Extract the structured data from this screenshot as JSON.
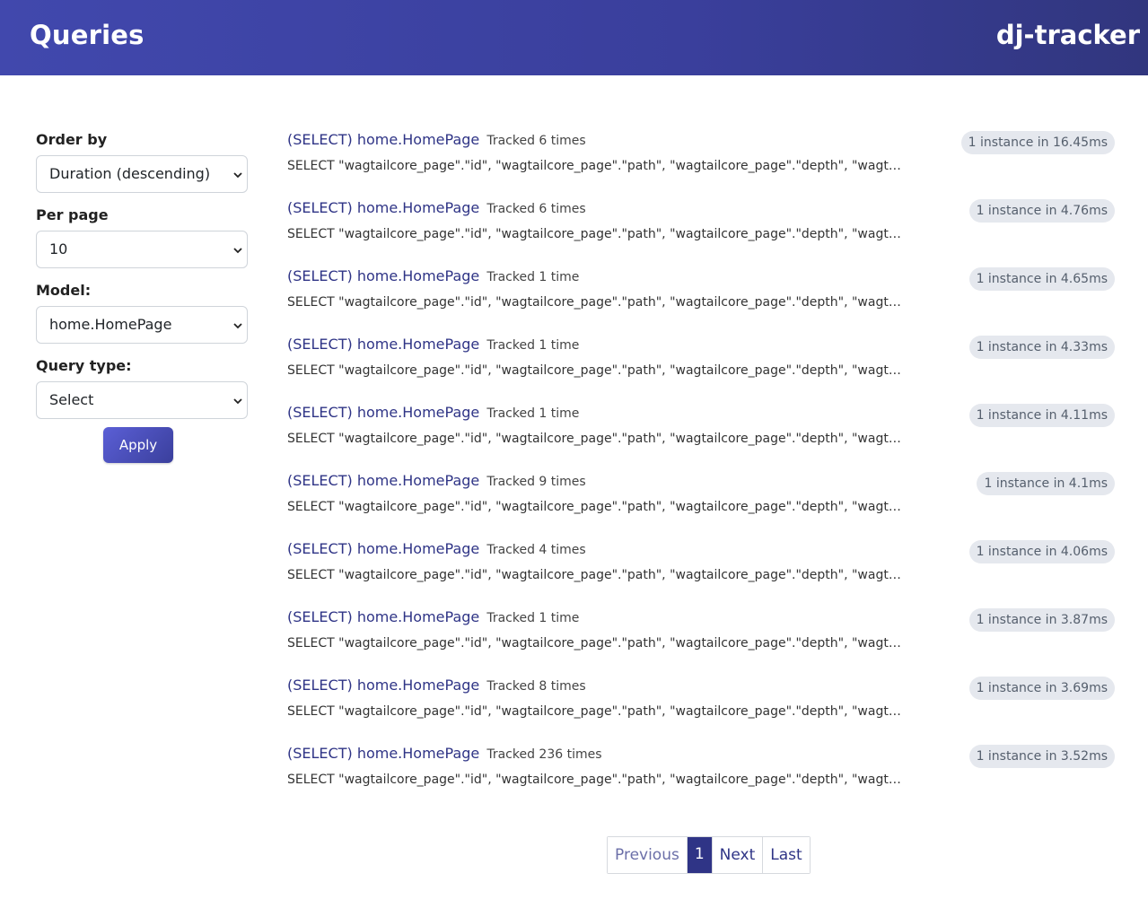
{
  "header": {
    "title": "Queries",
    "brand": "dj-tracker"
  },
  "filters": {
    "order_by": {
      "label": "Order by",
      "value": "Duration (descending)"
    },
    "per_page": {
      "label": "Per page",
      "value": "10"
    },
    "model": {
      "label": "Model:",
      "value": "home.HomePage"
    },
    "query_type": {
      "label": "Query type:",
      "value": "Select"
    },
    "apply_label": "Apply"
  },
  "queries": [
    {
      "type": "(SELECT)",
      "model": "home.HomePage",
      "tracked": "Tracked 6 times",
      "sql": "SELECT \"wagtailcore_page\".\"id\", \"wagtailcore_page\".\"path\", \"wagtailcore_page\".\"depth\", \"wagtailcore...",
      "badge": "1 instance in 16.45ms"
    },
    {
      "type": "(SELECT)",
      "model": "home.HomePage",
      "tracked": "Tracked 6 times",
      "sql": "SELECT \"wagtailcore_page\".\"id\", \"wagtailcore_page\".\"path\", \"wagtailcore_page\".\"depth\", \"wagtailcore...",
      "badge": "1 instance in 4.76ms"
    },
    {
      "type": "(SELECT)",
      "model": "home.HomePage",
      "tracked": "Tracked 1 time",
      "sql": "SELECT \"wagtailcore_page\".\"id\", \"wagtailcore_page\".\"path\", \"wagtailcore_page\".\"depth\", \"wagtailcore...",
      "badge": "1 instance in 4.65ms"
    },
    {
      "type": "(SELECT)",
      "model": "home.HomePage",
      "tracked": "Tracked 1 time",
      "sql": "SELECT \"wagtailcore_page\".\"id\", \"wagtailcore_page\".\"path\", \"wagtailcore_page\".\"depth\", \"wagtailcore...",
      "badge": "1 instance in 4.33ms"
    },
    {
      "type": "(SELECT)",
      "model": "home.HomePage",
      "tracked": "Tracked 1 time",
      "sql": "SELECT \"wagtailcore_page\".\"id\", \"wagtailcore_page\".\"path\", \"wagtailcore_page\".\"depth\", \"wagtailcore...",
      "badge": "1 instance in 4.11ms"
    },
    {
      "type": "(SELECT)",
      "model": "home.HomePage",
      "tracked": "Tracked 9 times",
      "sql": "SELECT \"wagtailcore_page\".\"id\", \"wagtailcore_page\".\"path\", \"wagtailcore_page\".\"depth\", \"wagtailcore...",
      "badge": "1 instance in 4.1ms"
    },
    {
      "type": "(SELECT)",
      "model": "home.HomePage",
      "tracked": "Tracked 4 times",
      "sql": "SELECT \"wagtailcore_page\".\"id\", \"wagtailcore_page\".\"path\", \"wagtailcore_page\".\"depth\", \"wagtailcore...",
      "badge": "1 instance in 4.06ms"
    },
    {
      "type": "(SELECT)",
      "model": "home.HomePage",
      "tracked": "Tracked 1 time",
      "sql": "SELECT \"wagtailcore_page\".\"id\", \"wagtailcore_page\".\"path\", \"wagtailcore_page\".\"depth\", \"wagtailcore...",
      "badge": "1 instance in 3.87ms"
    },
    {
      "type": "(SELECT)",
      "model": "home.HomePage",
      "tracked": "Tracked 8 times",
      "sql": "SELECT \"wagtailcore_page\".\"id\", \"wagtailcore_page\".\"path\", \"wagtailcore_page\".\"depth\", \"wagtailcore...",
      "badge": "1 instance in 3.69ms"
    },
    {
      "type": "(SELECT)",
      "model": "home.HomePage",
      "tracked": "Tracked 236 times",
      "sql": "SELECT \"wagtailcore_page\".\"id\", \"wagtailcore_page\".\"path\", \"wagtailcore_page\".\"depth\", \"wagtailcore...",
      "badge": "1 instance in 3.52ms"
    }
  ],
  "pagination": {
    "previous": "Previous",
    "current": "1",
    "next": "Next",
    "last": "Last"
  },
  "colors": {
    "header_start": "#4148ad",
    "header_end": "#31367e",
    "link": "#2f3486",
    "badge_bg": "#e5e8ee"
  },
  "icons": {
    "select_chevron": "chevron-down-icon"
  }
}
